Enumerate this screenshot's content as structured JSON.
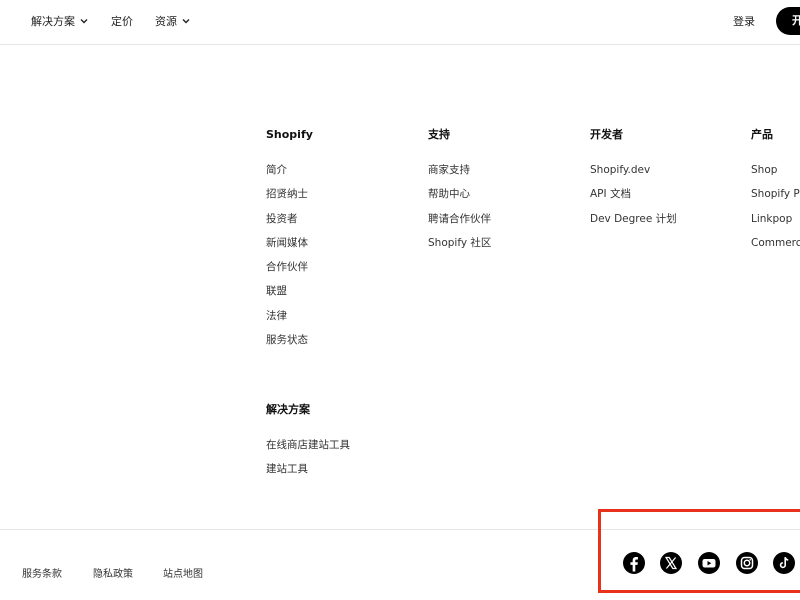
{
  "nav": {
    "solutions": "解决方案",
    "pricing": "定价",
    "resources": "资源",
    "login": "登录",
    "cta": "开"
  },
  "footer": {
    "columns": [
      {
        "title": "Shopify",
        "items": [
          "简介",
          "招贤纳士",
          "投资者",
          "新闻媒体",
          "合作伙伴",
          "联盟",
          "法律",
          "服务状态"
        ]
      },
      {
        "title": "支持",
        "items": [
          "商家支持",
          "帮助中心",
          "聘请合作伙伴",
          "Shopify 社区"
        ]
      },
      {
        "title": "开发者",
        "items": [
          "Shopify.dev",
          "API 文档",
          "Dev Degree 计划"
        ]
      },
      {
        "title": "产品",
        "items": [
          "Shop",
          "Shopify Pl",
          "Linkpop",
          "Commerce"
        ]
      },
      {
        "title": "解决方案",
        "items": [
          "在线商店建站工具",
          "建站工具"
        ]
      }
    ],
    "legal": {
      "terms": "服务条款",
      "privacy": "隐私政策",
      "sitemap": "站点地图"
    },
    "social_icons": [
      "facebook-icon",
      "x-icon",
      "youtube-icon",
      "instagram-icon",
      "tiktok-icon"
    ]
  },
  "colors": {
    "highlight": "#e8321c",
    "cta_bg": "#000000"
  }
}
